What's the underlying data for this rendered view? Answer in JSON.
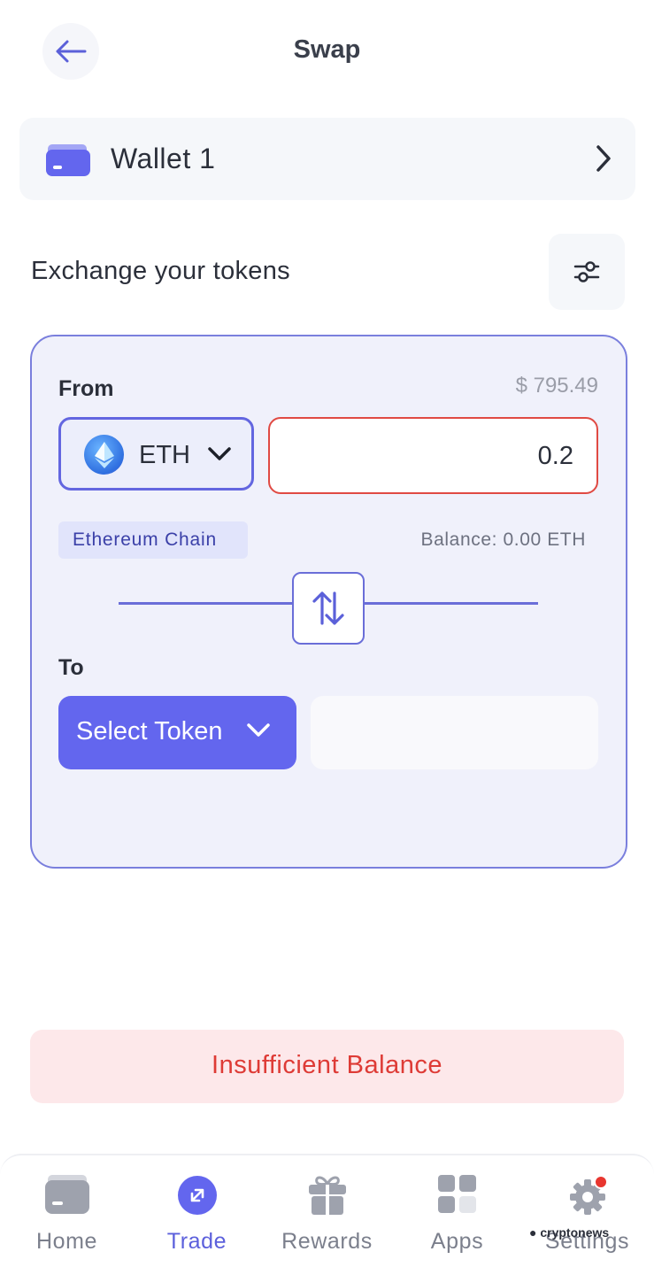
{
  "header": {
    "title": "Swap",
    "back_icon": "arrow-left-icon"
  },
  "wallet": {
    "name": "Wallet 1",
    "icon": "wallet-icon",
    "chevron_icon": "chevron-right-icon"
  },
  "exchange": {
    "title": "Exchange your tokens",
    "settings_icon": "sliders-icon"
  },
  "swap": {
    "from": {
      "label": "From",
      "usd_value": "$ 795.49",
      "token": "ETH",
      "token_icon": "ethereum-icon",
      "amount": "0.2",
      "chain": "Ethereum Chain",
      "balance": "Balance: 0.00 ETH"
    },
    "swap_icon": "swap-arrows-icon",
    "to": {
      "label": "To",
      "select_label": "Select Token",
      "amount": ""
    }
  },
  "action": {
    "label": "Insufficient Balance"
  },
  "nav": {
    "items": [
      {
        "label": "Home",
        "icon": "home-wallet-icon",
        "active": false
      },
      {
        "label": "Trade",
        "icon": "trade-icon",
        "active": true
      },
      {
        "label": "Rewards",
        "icon": "gift-icon",
        "active": false
      },
      {
        "label": "Apps",
        "icon": "apps-grid-icon",
        "active": false
      },
      {
        "label": "Settings",
        "icon": "gear-icon",
        "active": false
      }
    ]
  },
  "watermark": "cryptonews",
  "colors": {
    "accent": "#6366ee",
    "error": "#de3b36",
    "card_bg": "#f0f1fb",
    "notification_dot": "#e8362f"
  }
}
